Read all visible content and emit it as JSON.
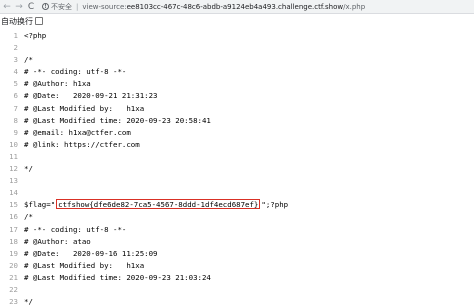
{
  "browser": {
    "back_icon": "←",
    "forward_icon": "→",
    "reload_icon": "C",
    "security_label": "不安全",
    "url_prefix": "view-source:",
    "url_host": "ee8103cc-467c-48c6-abdb-a9124eb4a493.challenge.ctf.show",
    "url_path": "/x.php"
  },
  "wrap": {
    "label": "自动换行"
  },
  "source_lines": [
    {
      "n": "1",
      "pre": "<?php",
      "flag": "",
      "post": ""
    },
    {
      "n": "2",
      "pre": "",
      "flag": "",
      "post": ""
    },
    {
      "n": "3",
      "pre": "/*",
      "flag": "",
      "post": ""
    },
    {
      "n": "4",
      "pre": "# -*- coding: utf-8 -*-",
      "flag": "",
      "post": ""
    },
    {
      "n": "5",
      "pre": "# @Author: h1xa",
      "flag": "",
      "post": ""
    },
    {
      "n": "6",
      "pre": "# @Date:   2020-09-21 21:31:23",
      "flag": "",
      "post": ""
    },
    {
      "n": "7",
      "pre": "# @Last Modified by:   h1xa",
      "flag": "",
      "post": ""
    },
    {
      "n": "8",
      "pre": "# @Last Modified time: 2020-09-23 20:58:41",
      "flag": "",
      "post": ""
    },
    {
      "n": "9",
      "pre": "# @email: h1xa@ctfer.com",
      "flag": "",
      "post": ""
    },
    {
      "n": "10",
      "pre": "# @link: https://ctfer.com",
      "flag": "",
      "post": ""
    },
    {
      "n": "11",
      "pre": "",
      "flag": "",
      "post": ""
    },
    {
      "n": "12",
      "pre": "*/",
      "flag": "",
      "post": ""
    },
    {
      "n": "13",
      "pre": "",
      "flag": "",
      "post": ""
    },
    {
      "n": "14",
      "pre": "",
      "flag": "",
      "post": ""
    },
    {
      "n": "15",
      "pre": "$flag=\"",
      "flag": "ctfshow{dfe6de82-7ca5-4567-8ddd-1df4ecd687ef}",
      "post": "\";?php"
    },
    {
      "n": "16",
      "pre": "/*",
      "flag": "",
      "post": ""
    },
    {
      "n": "17",
      "pre": "# -*- coding: utf-8 -*-",
      "flag": "",
      "post": ""
    },
    {
      "n": "18",
      "pre": "# @Author: atao",
      "flag": "",
      "post": ""
    },
    {
      "n": "19",
      "pre": "# @Date:   2020-09-16 11:25:09",
      "flag": "",
      "post": ""
    },
    {
      "n": "20",
      "pre": "# @Last Modified by:   h1xa",
      "flag": "",
      "post": ""
    },
    {
      "n": "21",
      "pre": "# @Last Modified time: 2020-09-23 21:03:24",
      "flag": "",
      "post": ""
    },
    {
      "n": "22",
      "pre": "",
      "flag": "",
      "post": ""
    },
    {
      "n": "23",
      "pre": "*/",
      "flag": "",
      "post": ""
    }
  ]
}
